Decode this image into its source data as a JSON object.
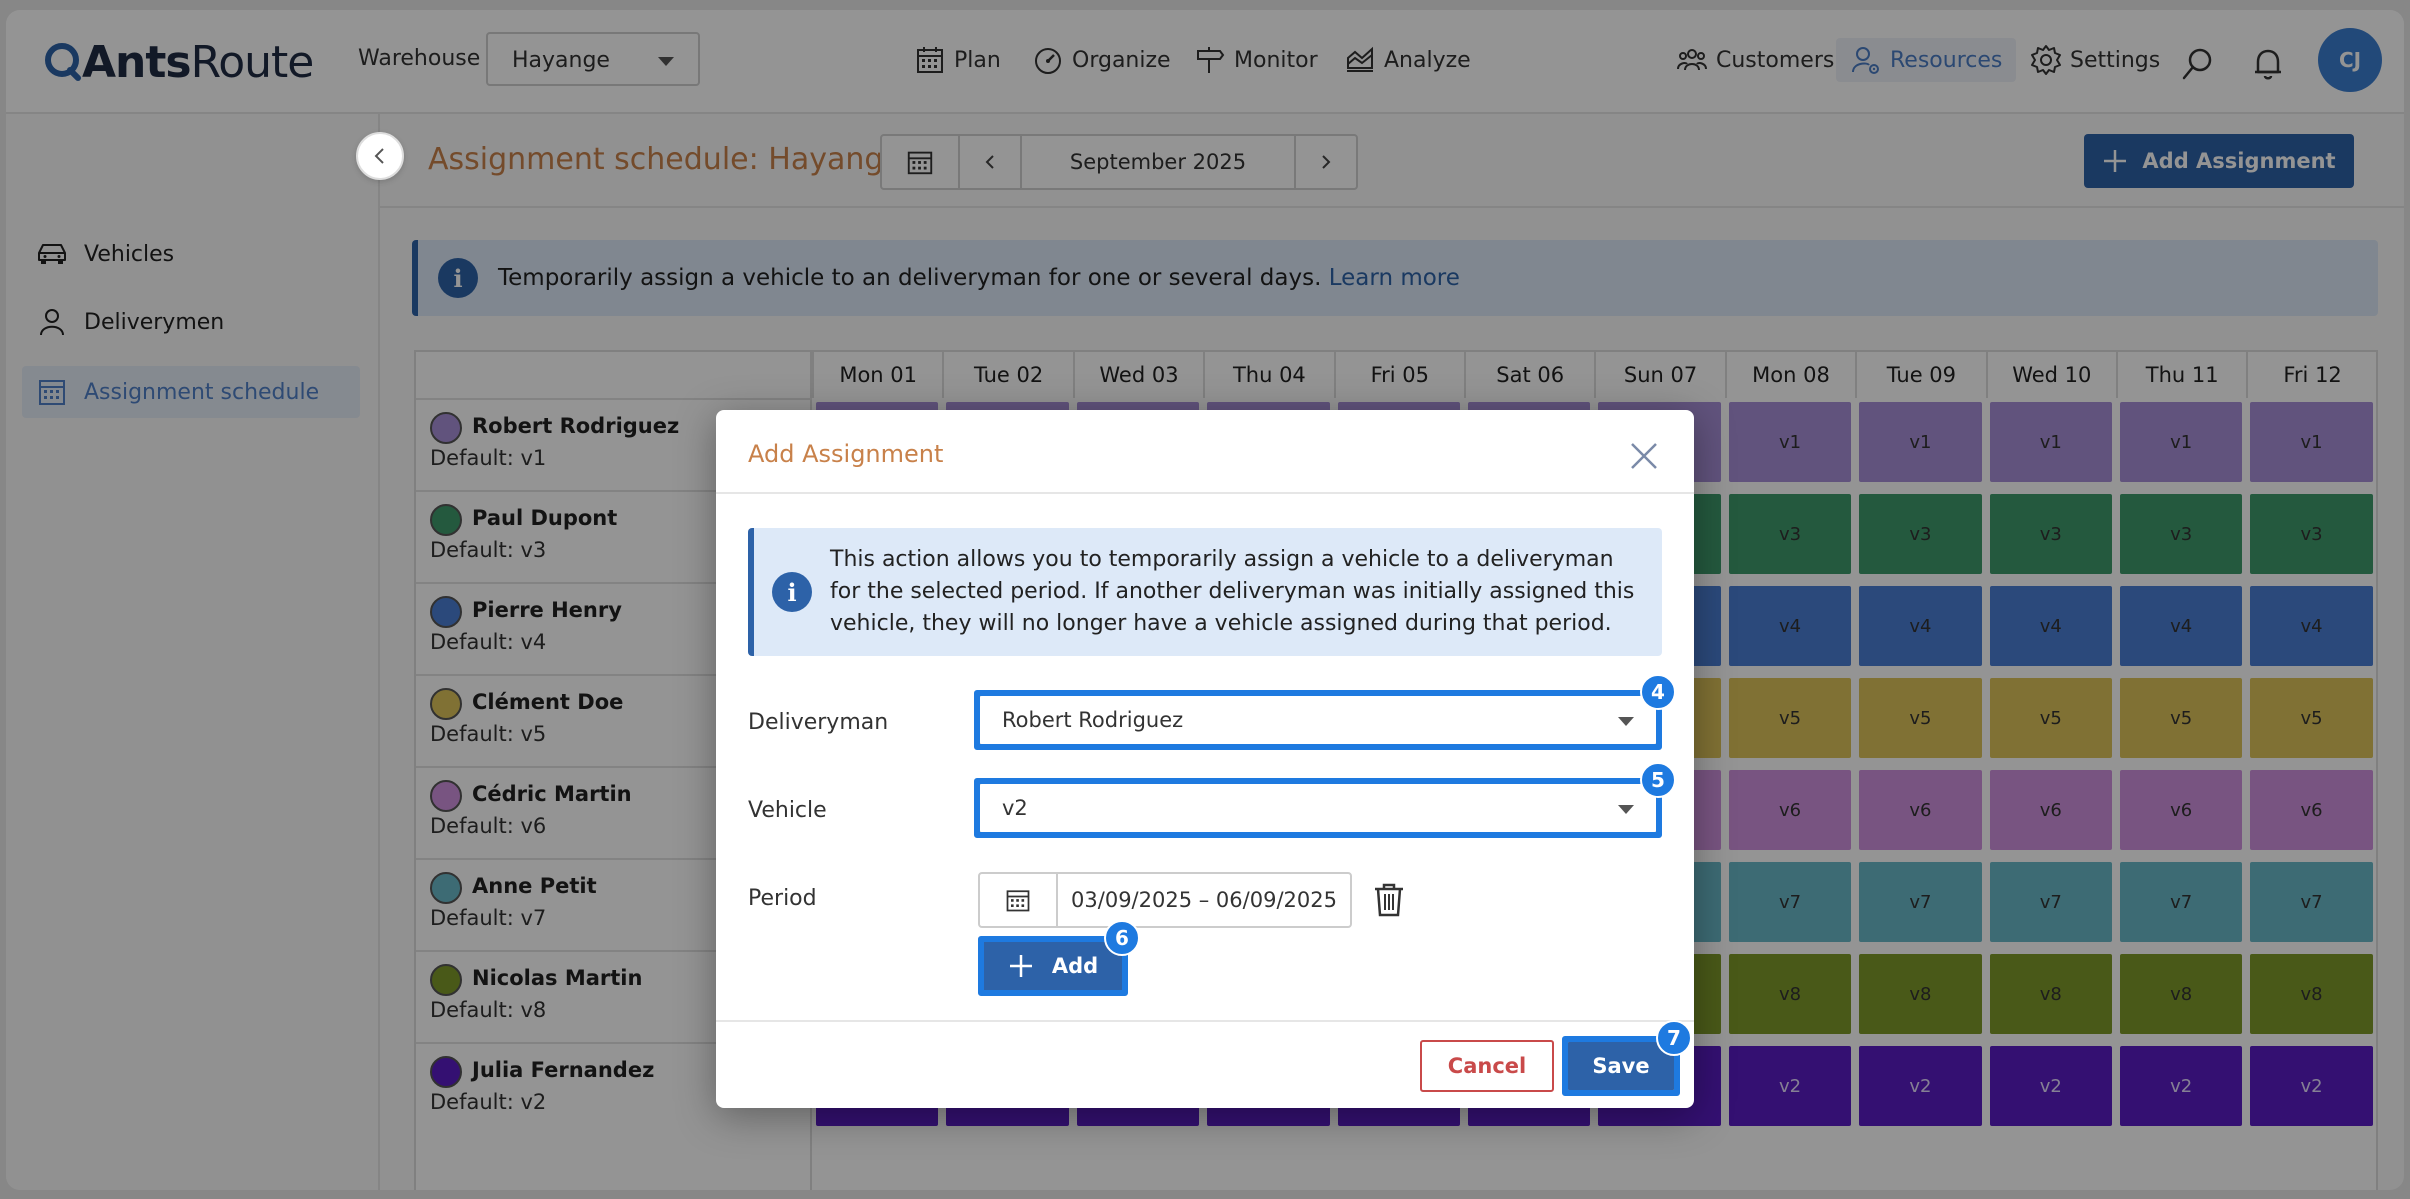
{
  "app": {
    "brand_bold": "Ants",
    "brand_light": "Route"
  },
  "header": {
    "warehouse_label": "Warehouse",
    "warehouse_value": "Hayange",
    "nav": [
      {
        "label": "Plan",
        "icon": "calendar-icon"
      },
      {
        "label": "Organize",
        "icon": "gauge-icon"
      },
      {
        "label": "Monitor",
        "icon": "signpost-icon"
      },
      {
        "label": "Analyze",
        "icon": "chart-icon"
      }
    ],
    "right_nav": [
      {
        "label": "Customers",
        "icon": "users-icon"
      },
      {
        "label": "Resources",
        "icon": "user-gear-icon",
        "active": true
      },
      {
        "label": "Settings",
        "icon": "gear-icon"
      }
    ],
    "avatar_initials": "CJ"
  },
  "sidebar": {
    "items": [
      {
        "label": "Vehicles",
        "icon": "car-icon"
      },
      {
        "label": "Deliverymen",
        "icon": "person-icon"
      },
      {
        "label": "Assignment schedule",
        "icon": "calendar-grid-icon",
        "active": true
      }
    ]
  },
  "page": {
    "title": "Assignment schedule: Hayange",
    "month": "September 2025",
    "add_assignment": "Add Assignment",
    "banner_text": "Temporarily assign a vehicle to an deliveryman for one or several days.",
    "banner_link": "Learn more"
  },
  "schedule": {
    "days": [
      "Mon 01",
      "Tue 02",
      "Wed 03",
      "Thu 04",
      "Fri 05",
      "Sat 06",
      "Sun 07",
      "Mon 08",
      "Tue 09",
      "Wed 10",
      "Thu 11",
      "Fri 12"
    ],
    "visible_from_day_index": 7,
    "rows": [
      {
        "name": "Robert Rodriguez",
        "default": "Default: v1",
        "vehicle": "v1",
        "color": "#a890d8"
      },
      {
        "name": "Paul Dupont",
        "default": "Default: v3",
        "vehicle": "v3",
        "color": "#3f9a6c"
      },
      {
        "name": "Pierre Henry",
        "default": "Default: v4",
        "vehicle": "v4",
        "color": "#4a7ed4"
      },
      {
        "name": "Clément Doe",
        "default": "Default: v5",
        "vehicle": "v5",
        "color": "#dcc35a"
      },
      {
        "name": "Cédric Martin",
        "default": "Default: v6",
        "vehicle": "v6",
        "color": "#cf92de"
      },
      {
        "name": "Anne Petit",
        "default": "Default: v7",
        "vehicle": "v7",
        "color": "#6ab9c8"
      },
      {
        "name": "Nicolas Martin",
        "default": "Default: v8",
        "vehicle": "v8",
        "color": "#7f9a2a"
      },
      {
        "name": "Julia Fernandez",
        "default": "Default: v2",
        "vehicle": "v2",
        "color": "#5a1cc4"
      }
    ]
  },
  "modal": {
    "title": "Add Assignment",
    "info": "This action allows you to temporarily assign a vehicle to a deliveryman for the selected period. If another deliveryman was initially assigned this vehicle, they will no longer have a vehicle assigned during that period.",
    "deliveryman_label": "Deliveryman",
    "deliveryman_value": "Robert Rodriguez",
    "vehicle_label": "Vehicle",
    "vehicle_value": "v2",
    "period_label": "Period",
    "period_value": "03/09/2025 – 06/09/2025",
    "add_label": "Add",
    "cancel_label": "Cancel",
    "save_label": "Save",
    "badges": {
      "deliveryman": "4",
      "vehicle": "5",
      "add": "6",
      "save": "7"
    }
  },
  "colors": {
    "accent": "#2d62a8",
    "title": "#c8814a",
    "highlight": "#1e7ae0",
    "danger": "#c94a4a"
  }
}
